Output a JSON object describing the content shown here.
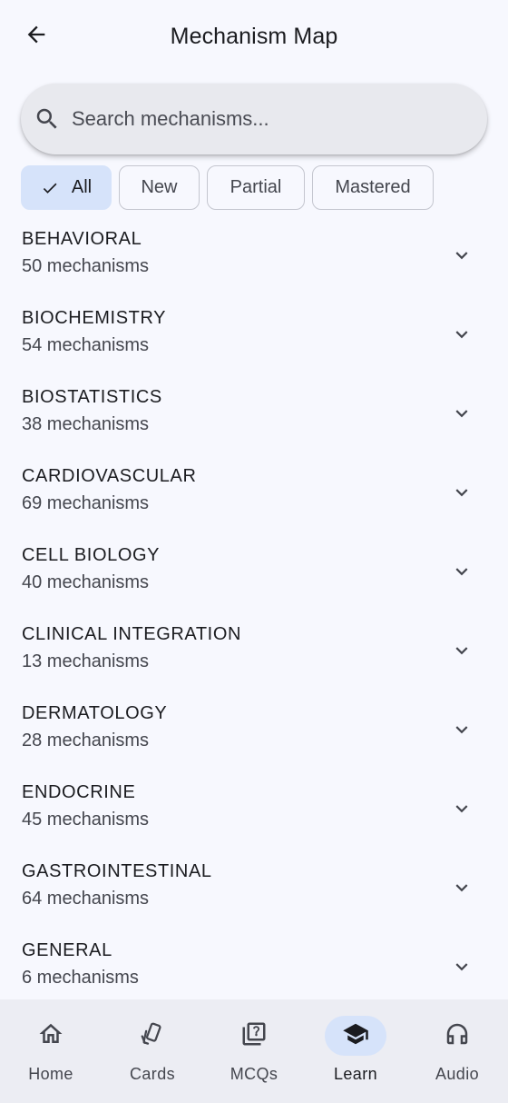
{
  "appbar": {
    "title": "Mechanism Map",
    "back_icon": "arrow-left-icon"
  },
  "search": {
    "placeholder": "Search mechanisms...",
    "value": "",
    "icon": "search-icon"
  },
  "filters": {
    "selected": "All",
    "chips": [
      {
        "label": "All",
        "selected": true
      },
      {
        "label": "New",
        "selected": false
      },
      {
        "label": "Partial",
        "selected": false
      },
      {
        "label": "Mastered",
        "selected": false
      }
    ]
  },
  "categories": [
    {
      "name": "BEHAVIORAL",
      "count": "50 mechanisms"
    },
    {
      "name": "BIOCHEMISTRY",
      "count": "54 mechanisms"
    },
    {
      "name": "BIOSTATISTICS",
      "count": "38 mechanisms"
    },
    {
      "name": "CARDIOVASCULAR",
      "count": "69 mechanisms"
    },
    {
      "name": "CELL BIOLOGY",
      "count": "40 mechanisms"
    },
    {
      "name": "CLINICAL INTEGRATION",
      "count": "13 mechanisms"
    },
    {
      "name": "DERMATOLOGY",
      "count": "28 mechanisms"
    },
    {
      "name": "ENDOCRINE",
      "count": "45 mechanisms"
    },
    {
      "name": "GASTROINTESTINAL",
      "count": "64 mechanisms"
    },
    {
      "name": "GENERAL",
      "count": "6 mechanisms"
    }
  ],
  "bottom_nav": {
    "active": "Learn",
    "items": [
      {
        "label": "Home",
        "icon": "home-icon"
      },
      {
        "label": "Cards",
        "icon": "cards-icon"
      },
      {
        "label": "MCQs",
        "icon": "quiz-icon"
      },
      {
        "label": "Learn",
        "icon": "school-icon"
      },
      {
        "label": "Audio",
        "icon": "headphones-icon"
      }
    ]
  },
  "colors": {
    "background": "#f7f8fe",
    "search_bg": "#e8e9ee",
    "chip_selected_bg": "#d6e3fa",
    "chip_border": "#c4c6cf",
    "nav_bg": "#ecedf3",
    "nav_active_pill": "#d6e3fa",
    "text_primary": "#1b1c20",
    "text_secondary": "#44464e"
  }
}
